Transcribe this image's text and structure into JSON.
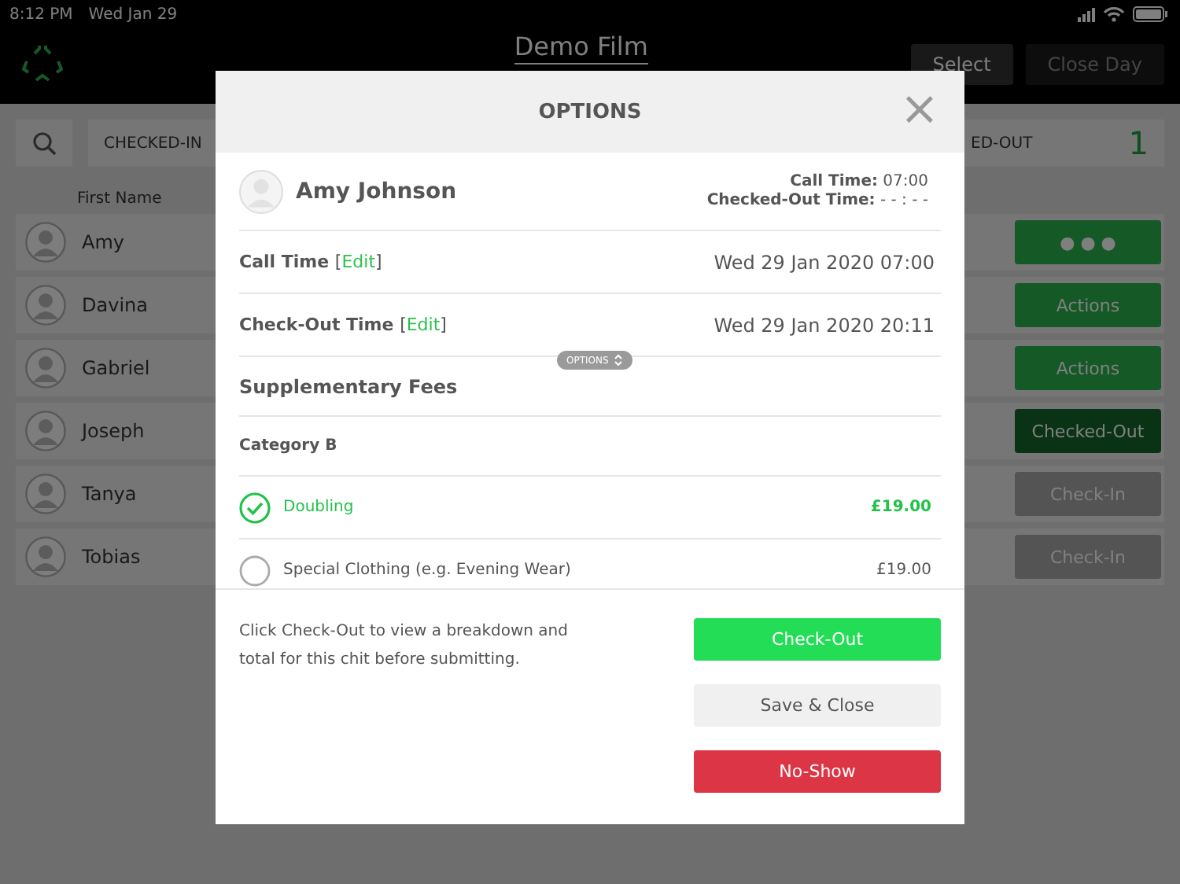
{
  "status_bar": {
    "time": "8:12 PM",
    "date": "Wed Jan 29"
  },
  "header": {
    "title": "Demo Film",
    "buttons": [
      {
        "label": "Select",
        "disabled": false
      },
      {
        "label": "Close Day",
        "disabled": true
      }
    ]
  },
  "filter_bar": {
    "left_label": "CHECKED-IN",
    "right_label": "ED-OUT",
    "count": "1"
  },
  "list": {
    "column_header": "First Name",
    "rows": [
      {
        "name": "Amy",
        "action": {
          "kind": "dots",
          "label": "● ● ●"
        }
      },
      {
        "name": "Davina",
        "action": {
          "kind": "actions",
          "label": "Actions"
        }
      },
      {
        "name": "Gabriel",
        "action": {
          "kind": "actions",
          "label": "Actions"
        }
      },
      {
        "name": "Joseph",
        "action": {
          "kind": "checked-out",
          "label": "Checked-Out"
        }
      },
      {
        "name": "Tanya",
        "action": {
          "kind": "check-in",
          "label": "Check-In"
        }
      },
      {
        "name": "Tobias",
        "action": {
          "kind": "check-in",
          "label": "Check-In"
        }
      }
    ]
  },
  "modal": {
    "title": "OPTIONS",
    "close": "×",
    "person": {
      "name": "Amy Johnson",
      "details": [
        "**Call Time:** 07:00",
        "**Checked-Out Time:** - - : - -"
      ]
    },
    "time_rows": [
      {
        "label": "Call Time",
        "open": "[",
        "link": "Edit",
        "close": "]",
        "value": "Wed 29 Jan 2020 07:00"
      },
      {
        "label": "Check-Out Time",
        "open": "[",
        "link": "Edit",
        "close": "]",
        "value": "Wed 29 Jan 2020 20:11"
      }
    ],
    "options_pill": "OPTIONS",
    "section_title": "Supplementary Fees",
    "category": "Category B",
    "fees": [
      {
        "name": "Doubling",
        "price": "£19.00",
        "checked": true
      },
      {
        "name": "Special Clothing (e.g. Evening Wear)",
        "price": "£19.00",
        "checked": false
      }
    ],
    "note": "Click Check-Out to view a breakdown and total for this chit before submitting.",
    "buttons": [
      {
        "kind": "primary",
        "label": "Check-Out"
      },
      {
        "kind": "secondary",
        "label": "Save & Close"
      },
      {
        "kind": "danger",
        "label": "No-Show"
      }
    ]
  }
}
